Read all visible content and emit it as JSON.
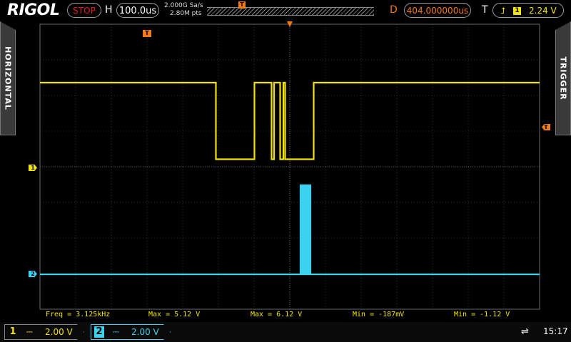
{
  "header": {
    "brand": "RIGOL",
    "run_state": "STOP",
    "horizontal_label": "H",
    "timebase": "100.0us",
    "sample_rate": "2.000G Sa/s",
    "memory_depth": "2.80M pts",
    "delay_label": "D",
    "delay_value": "404.000000us",
    "trigger_label": "T",
    "trigger_source": "1",
    "trigger_level": "2.24 V"
  },
  "side_tabs": {
    "left": "HORIZONTAL",
    "right": "TRIGGER"
  },
  "channels": [
    {
      "id": "1",
      "color": "#f3e300",
      "scale": "2.00 V",
      "coupling": "DC"
    },
    {
      "id": "2",
      "color": "#3ad2f0",
      "scale": "2.00 V",
      "coupling": "DC"
    }
  ],
  "markers": {
    "trigger_position": "T",
    "trigger_level": "T",
    "ch1_ground": "1",
    "ch2_ground": "2"
  },
  "measurements": [
    {
      "text": "Freq = 3.125kHz"
    },
    {
      "text": "Max = 5.12 V"
    },
    {
      "text": "Max = 6.12 V"
    },
    {
      "text": "Min = -187mV"
    },
    {
      "text": "Min = -1.12 V"
    }
  ],
  "status": {
    "clock": "15:17",
    "usb_icon": "usb-icon"
  },
  "colors": {
    "accent_orange": "#f07b18",
    "ch1": "#f3e300",
    "ch2": "#3ad2f0",
    "grid": "#5a5a5a"
  },
  "waveforms": {
    "ch1_edges_us": [
      -207.0,
      -99.0,
      -51.0,
      -44.0,
      -27.0,
      -18.0,
      -13.0,
      67.0
    ],
    "ch1_high_V": 4.8,
    "ch1_low_V": 0.5,
    "ch2_pulses_us": [
      30.0,
      34.0,
      38.0,
      42.0,
      46.0
    ],
    "ch2_high_V": 5.0,
    "ch2_low_V": 0.0
  }
}
